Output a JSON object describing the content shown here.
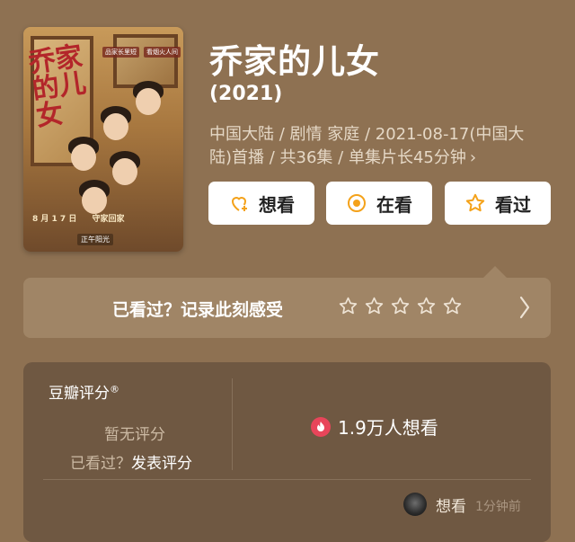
{
  "poster": {
    "title_art": "乔家的儿女",
    "tag1": "品家长里短",
    "tag2": "看烟火人间",
    "date": "8 月 1 7 日",
    "premiere_tag": "守家回家",
    "bottom_label": "正午阳光"
  },
  "title": "乔家的儿女",
  "year": "(2021)",
  "meta_line1": "中国大陆 / 剧情 家庭 / 2021-08-17(中国大",
  "meta_line2": "陆)首播 / 共36集 / 单集片长45分钟",
  "meta_chevron": "›",
  "buttons": {
    "want": "想看",
    "watching": "在看",
    "watched": "看过"
  },
  "rating_prompt": "已看过？记录此刻感受",
  "panel": {
    "title": "豆瓣评分",
    "title_mark": "®",
    "no_score": "暂无评分",
    "watched_question": "已看过？",
    "post_score": "发表评分",
    "want_count": "1.9万人想看",
    "feed_action": "想看",
    "feed_time": "1分钟前"
  },
  "colors": {
    "background": "#8e7152",
    "button_accent": "#f4a21a",
    "fire": "#e8455a"
  }
}
